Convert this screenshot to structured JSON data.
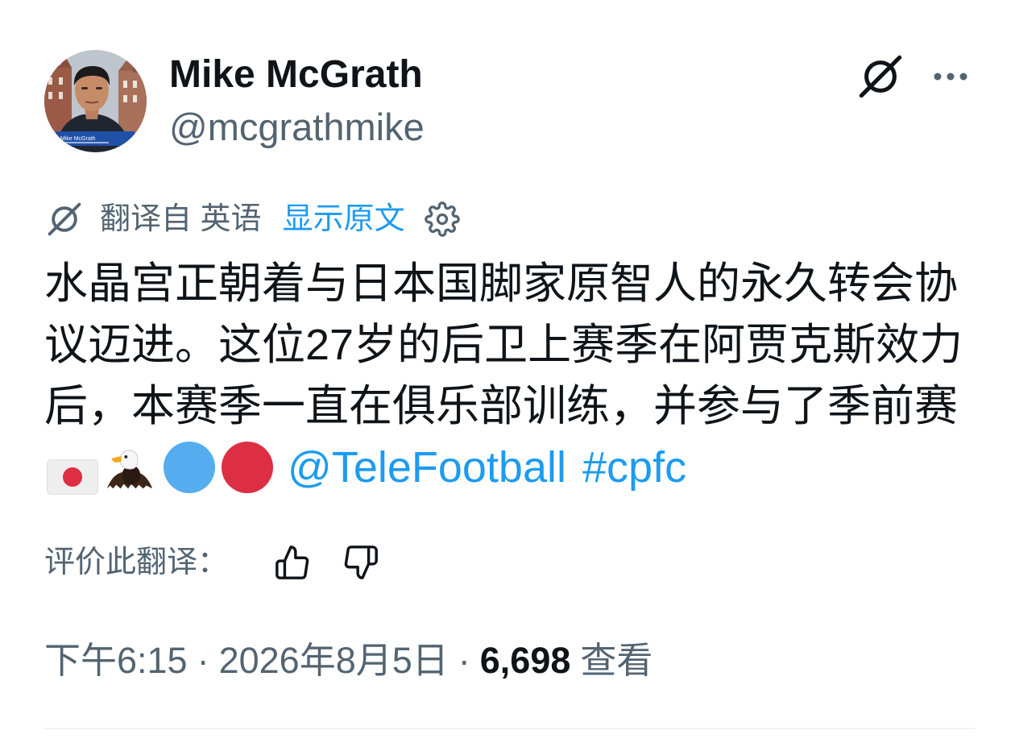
{
  "author": {
    "name": "Mike McGrath",
    "handle": "@mcgrathmike",
    "avatar_caption": "Mike McGrath"
  },
  "header_actions": {
    "grok_icon": "grok-icon",
    "more_icon": "more-dots-icon"
  },
  "translation": {
    "icon": "grok-icon",
    "translated_from": "翻译自 英语",
    "show_original": "显示原文",
    "settings_icon": "gear-icon"
  },
  "tweet": {
    "lines": [
      "水晶宫正朝着与日本国脚家原智人的永久转会协",
      "议迈进。这位27岁的后卫上赛季在阿贾克斯效力",
      "后，本赛季一直在俱乐部训练，并参与了季前赛"
    ],
    "emoji": [
      "japan-flag-emoji",
      "eagle-emoji",
      "blue-circle-emoji",
      "red-circle-emoji"
    ],
    "mention": "@TeleFootball",
    "hashtag": "#cpfc"
  },
  "rate_translation": {
    "label": "评价此翻译：",
    "like_icon": "thumbs-up-icon",
    "dislike_icon": "thumbs-down-icon"
  },
  "meta": {
    "time": "下午6:15",
    "separator": "·",
    "date": "2026年8月5日",
    "views_count": "6,698",
    "views_label": "查看"
  },
  "colors": {
    "text": "#0f1419",
    "secondary": "#536471",
    "link": "#1d9bf0",
    "divider": "#eff3f4"
  }
}
